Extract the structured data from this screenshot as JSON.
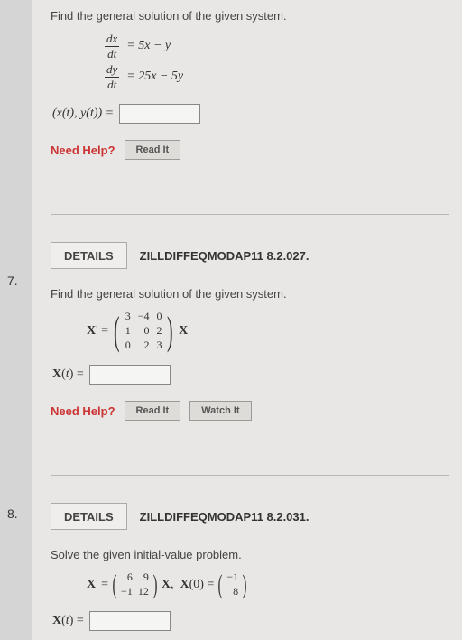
{
  "p6": {
    "prompt": "Find the general solution of the given system.",
    "eq1_lhs_num": "dx",
    "eq1_lhs_den": "dt",
    "eq1_rhs": "= 5x − y",
    "eq2_lhs_num": "dy",
    "eq2_lhs_den": "dt",
    "eq2_rhs": "= 25x − 5y",
    "ans_label": "(x(t), y(t)) =",
    "need_label": "Need Help?",
    "read_btn": "Read It"
  },
  "p7": {
    "num": "7.",
    "details_btn": "DETAILS",
    "source": "ZILLDIFFEQMODAP11 8.2.027.",
    "prompt": "Find the general solution of the given system.",
    "xprime": "X' =",
    "m": [
      "3",
      "−4",
      "0",
      "1",
      "0",
      "2",
      "0",
      "2",
      "3"
    ],
    "xtrail": "X",
    "ans_label": "X(t) =",
    "need_label": "Need Help?",
    "read_btn": "Read It",
    "watch_btn": "Watch It"
  },
  "p8": {
    "num": "8.",
    "details_btn": "DETAILS",
    "source": "ZILLDIFFEQMODAP11 8.2.031.",
    "prompt": "Solve the given initial-value problem.",
    "xprime": "X' =",
    "m": [
      "6",
      "9",
      "−1",
      "12"
    ],
    "mid": "X,  X(0) =",
    "v": [
      "−1",
      "8"
    ],
    "ans_label": "X(t) ="
  }
}
